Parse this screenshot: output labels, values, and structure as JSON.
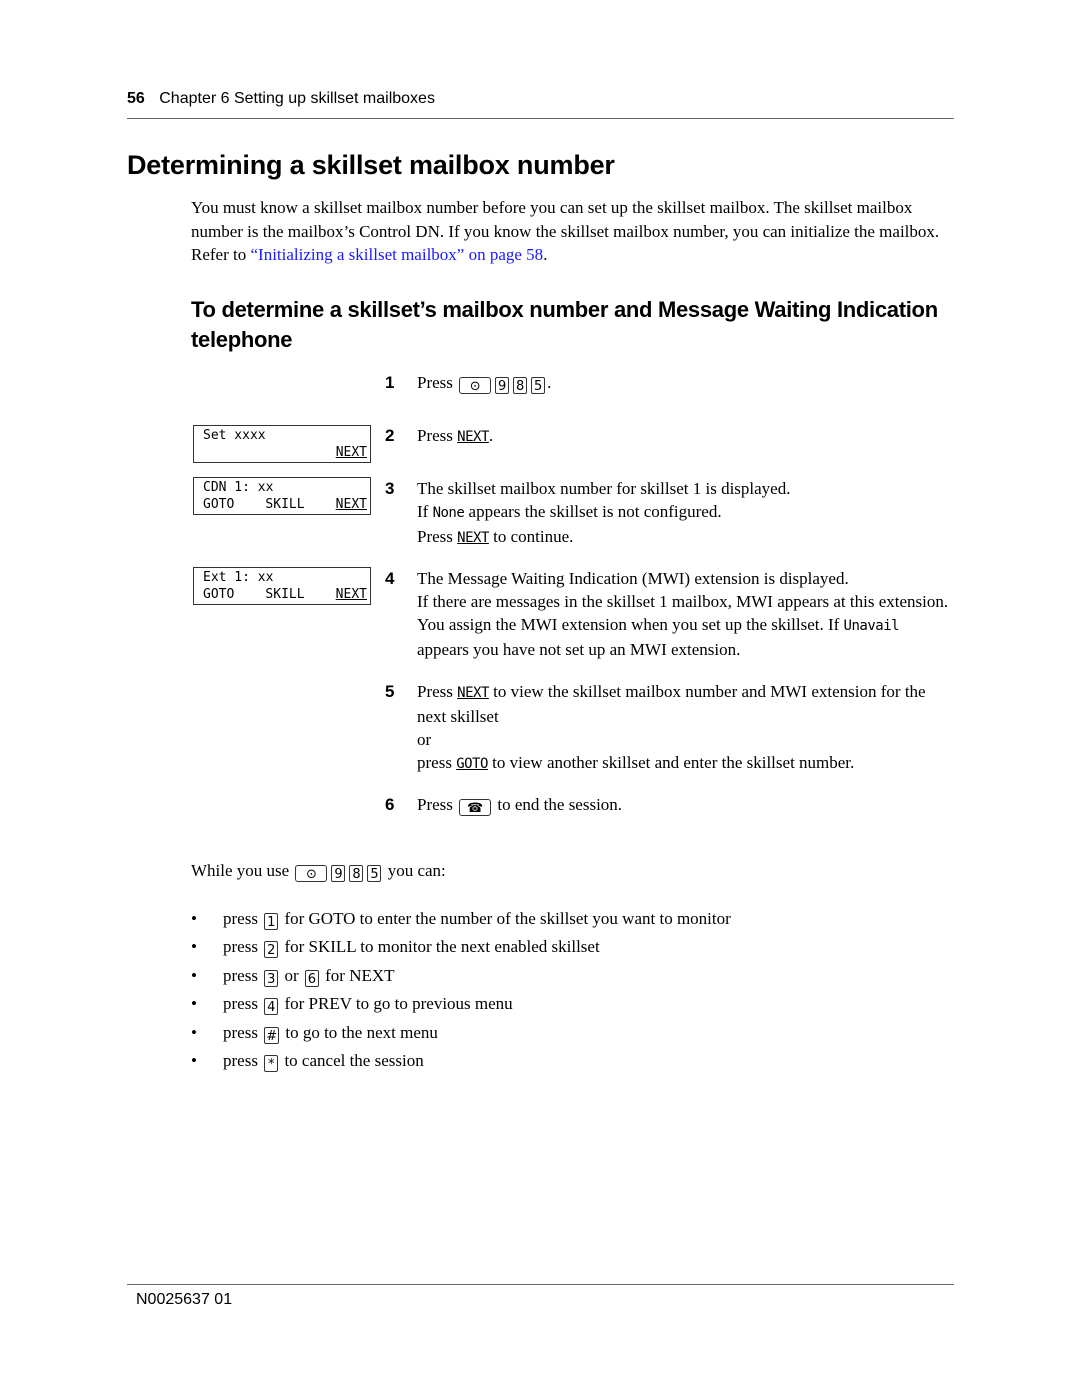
{
  "header": {
    "page_number": "56",
    "chapter": "Chapter 6  Setting up skillset mailboxes"
  },
  "title": "Determining a skillset mailbox number",
  "intro": {
    "text": "You must know a skillset mailbox number before you can set up the skillset mailbox. The skillset mailbox number is the mailbox’s Control DN. If you know the skillset mailbox number, you can initialize the mailbox. Refer to ",
    "link_text": "“Initializing a skillset mailbox” on page 58",
    "after": "."
  },
  "subheading": "To determine a skillset’s mailbox number and Message Waiting Indication telephone",
  "keys": {
    "feature": "⊙",
    "nine": "9",
    "eight": "8",
    "five": "5",
    "release": "☎"
  },
  "steps": [
    {
      "num": "1",
      "press": "Press",
      "end": "."
    },
    {
      "num": "2",
      "press": "Press",
      "softkey": "NEXT",
      "end": "."
    },
    {
      "num": "3",
      "line1": "The skillset mailbox number for skillset 1 is displayed.",
      "line2_pre": "If ",
      "line2_code": "None",
      "line2_post": " appears the skillset is not configured.",
      "line3_pre": "Press ",
      "line3_soft": "NEXT",
      "line3_post": " to continue."
    },
    {
      "num": "4",
      "line1": "The Message Waiting Indication (MWI) extension is displayed.",
      "line2": "If there are messages in the skillset 1 mailbox, MWI appears at this extension. You assign the MWI extension when you set up the skillset. If ",
      "code": "Unavail",
      "line2_post": " appears you have not set up an MWI extension."
    },
    {
      "num": "5",
      "pre": "Press ",
      "soft": "NEXT",
      "post": " to view the skillset mailbox number and MWI extension for the next skillset",
      "or": "or",
      "alt_pre": "press ",
      "alt_soft": "GOTO",
      "alt_post": " to view another skillset and enter the skillset number."
    },
    {
      "num": "6",
      "pre": "Press",
      "post": "to end the session."
    }
  ],
  "lcd_displays": [
    {
      "line1": "Set xxxx",
      "softkeys": [
        "NEXT"
      ]
    },
    {
      "line1": "CDN 1: xx",
      "softkeys": [
        "GOTO",
        "SKILL",
        "NEXT"
      ]
    },
    {
      "line1": "Ext 1: xx",
      "softkeys": [
        "GOTO",
        "SKILL",
        "NEXT"
      ]
    }
  ],
  "while_use": {
    "pre": "While you use",
    "post": "you can:"
  },
  "bullets": [
    {
      "pre": "press",
      "keys": [
        "1"
      ],
      "text": "for GOTO to enter the number of the skillset you want to monitor"
    },
    {
      "pre": "press",
      "keys": [
        "2"
      ],
      "text": "for SKILL to monitor the next enabled skillset"
    },
    {
      "pre": "press",
      "keys": [
        "3",
        "6"
      ],
      "joiner": "or",
      "text": "for NEXT"
    },
    {
      "pre": "press",
      "keys": [
        "4"
      ],
      "text": "for PREV to go to previous menu"
    },
    {
      "pre": "press",
      "keys": [
        "#"
      ],
      "text": "to go to the next menu"
    },
    {
      "pre": "press",
      "keys": [
        "*"
      ],
      "text": "to cancel the session"
    }
  ],
  "footer": {
    "doc_number": "N0025637 01"
  }
}
